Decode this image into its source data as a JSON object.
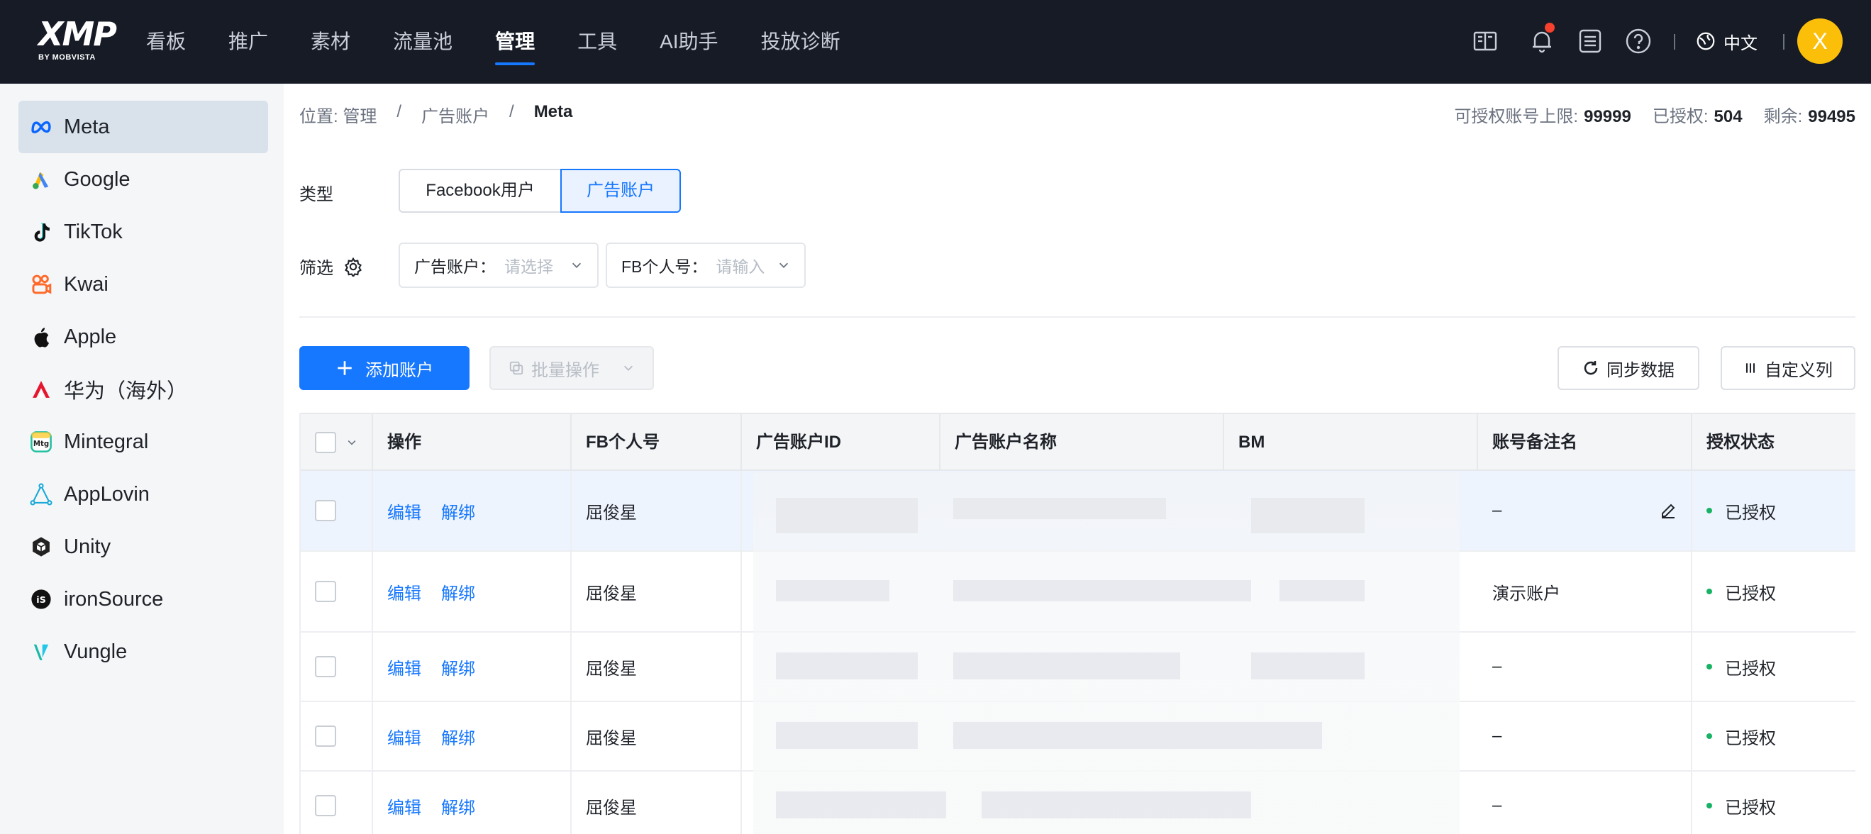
{
  "topbar": {
    "logo_main": "XMP",
    "logo_sub": "BY MOBVISTA",
    "nav": [
      {
        "label": "看板"
      },
      {
        "label": "推广"
      },
      {
        "label": "素材"
      },
      {
        "label": "流量池"
      },
      {
        "label": "管理",
        "active": true
      },
      {
        "label": "工具"
      },
      {
        "label": "AI助手"
      },
      {
        "label": "投放诊断"
      }
    ],
    "language": "中文",
    "avatar_letter": "X",
    "icons": [
      "book-icon",
      "bell-icon",
      "list-icon",
      "help-icon",
      "globe-icon"
    ]
  },
  "sidebar": {
    "items": [
      {
        "label": "Meta",
        "icon": "meta-icon",
        "active": true
      },
      {
        "label": "Google",
        "icon": "google-icon"
      },
      {
        "label": "TikTok",
        "icon": "tiktok-icon"
      },
      {
        "label": "Kwai",
        "icon": "kwai-icon"
      },
      {
        "label": "Apple",
        "icon": "apple-icon"
      },
      {
        "label": "华为（海外）",
        "icon": "huawei-icon"
      },
      {
        "label": "Mintegral",
        "icon": "mintegral-icon"
      },
      {
        "label": "AppLovin",
        "icon": "applovin-icon"
      },
      {
        "label": "Unity",
        "icon": "unity-icon"
      },
      {
        "label": "ironSource",
        "icon": "ironsource-icon"
      },
      {
        "label": "Vungle",
        "icon": "vungle-icon"
      }
    ]
  },
  "breadcrumb": {
    "prefix": "位置: 管理",
    "sep1": "/",
    "middle": "广告账户",
    "sep2": "/",
    "current": "Meta"
  },
  "quota": {
    "limit_label": "可授权账号上限:",
    "limit_value": "99999",
    "used_label": "已授权:",
    "used_value": "504",
    "remain_label": "剩余:",
    "remain_value": "99495"
  },
  "type_filter": {
    "label": "类型",
    "options": [
      "Facebook用户",
      "广告账户"
    ],
    "selected": "广告账户"
  },
  "filters": {
    "label": "筛选",
    "ad_account": {
      "label": "广告账户：",
      "placeholder": "请选择"
    },
    "fb_user": {
      "label": "FB个人号：",
      "placeholder": "请输入"
    }
  },
  "toolbar": {
    "add_label": "添加账户",
    "batch_label": "批量操作",
    "sync_label": "同步数据",
    "columns_label": "自定义列"
  },
  "table": {
    "columns": [
      "操作",
      "FB个人号",
      "广告账户ID",
      "广告账户名称",
      "BM",
      "账号备注名",
      "授权状态"
    ],
    "actions": {
      "edit": "编辑",
      "unbind": "解绑"
    },
    "rows": [
      {
        "fb_user": "屈俊星",
        "remark": "–",
        "status": "已授权"
      },
      {
        "fb_user": "屈俊星",
        "remark": "演示账户",
        "status": "已授权"
      },
      {
        "fb_user": "屈俊星",
        "remark": "–",
        "status": "已授权"
      },
      {
        "fb_user": "屈俊星",
        "remark": "–",
        "status": "已授权"
      },
      {
        "fb_user": "屈俊星",
        "remark": "–",
        "status": "已授权"
      }
    ]
  },
  "colors": {
    "primary": "#1677ff",
    "topbar_bg": "#161b26",
    "status_green": "#16b364",
    "avatar": "#fbbf0a"
  }
}
